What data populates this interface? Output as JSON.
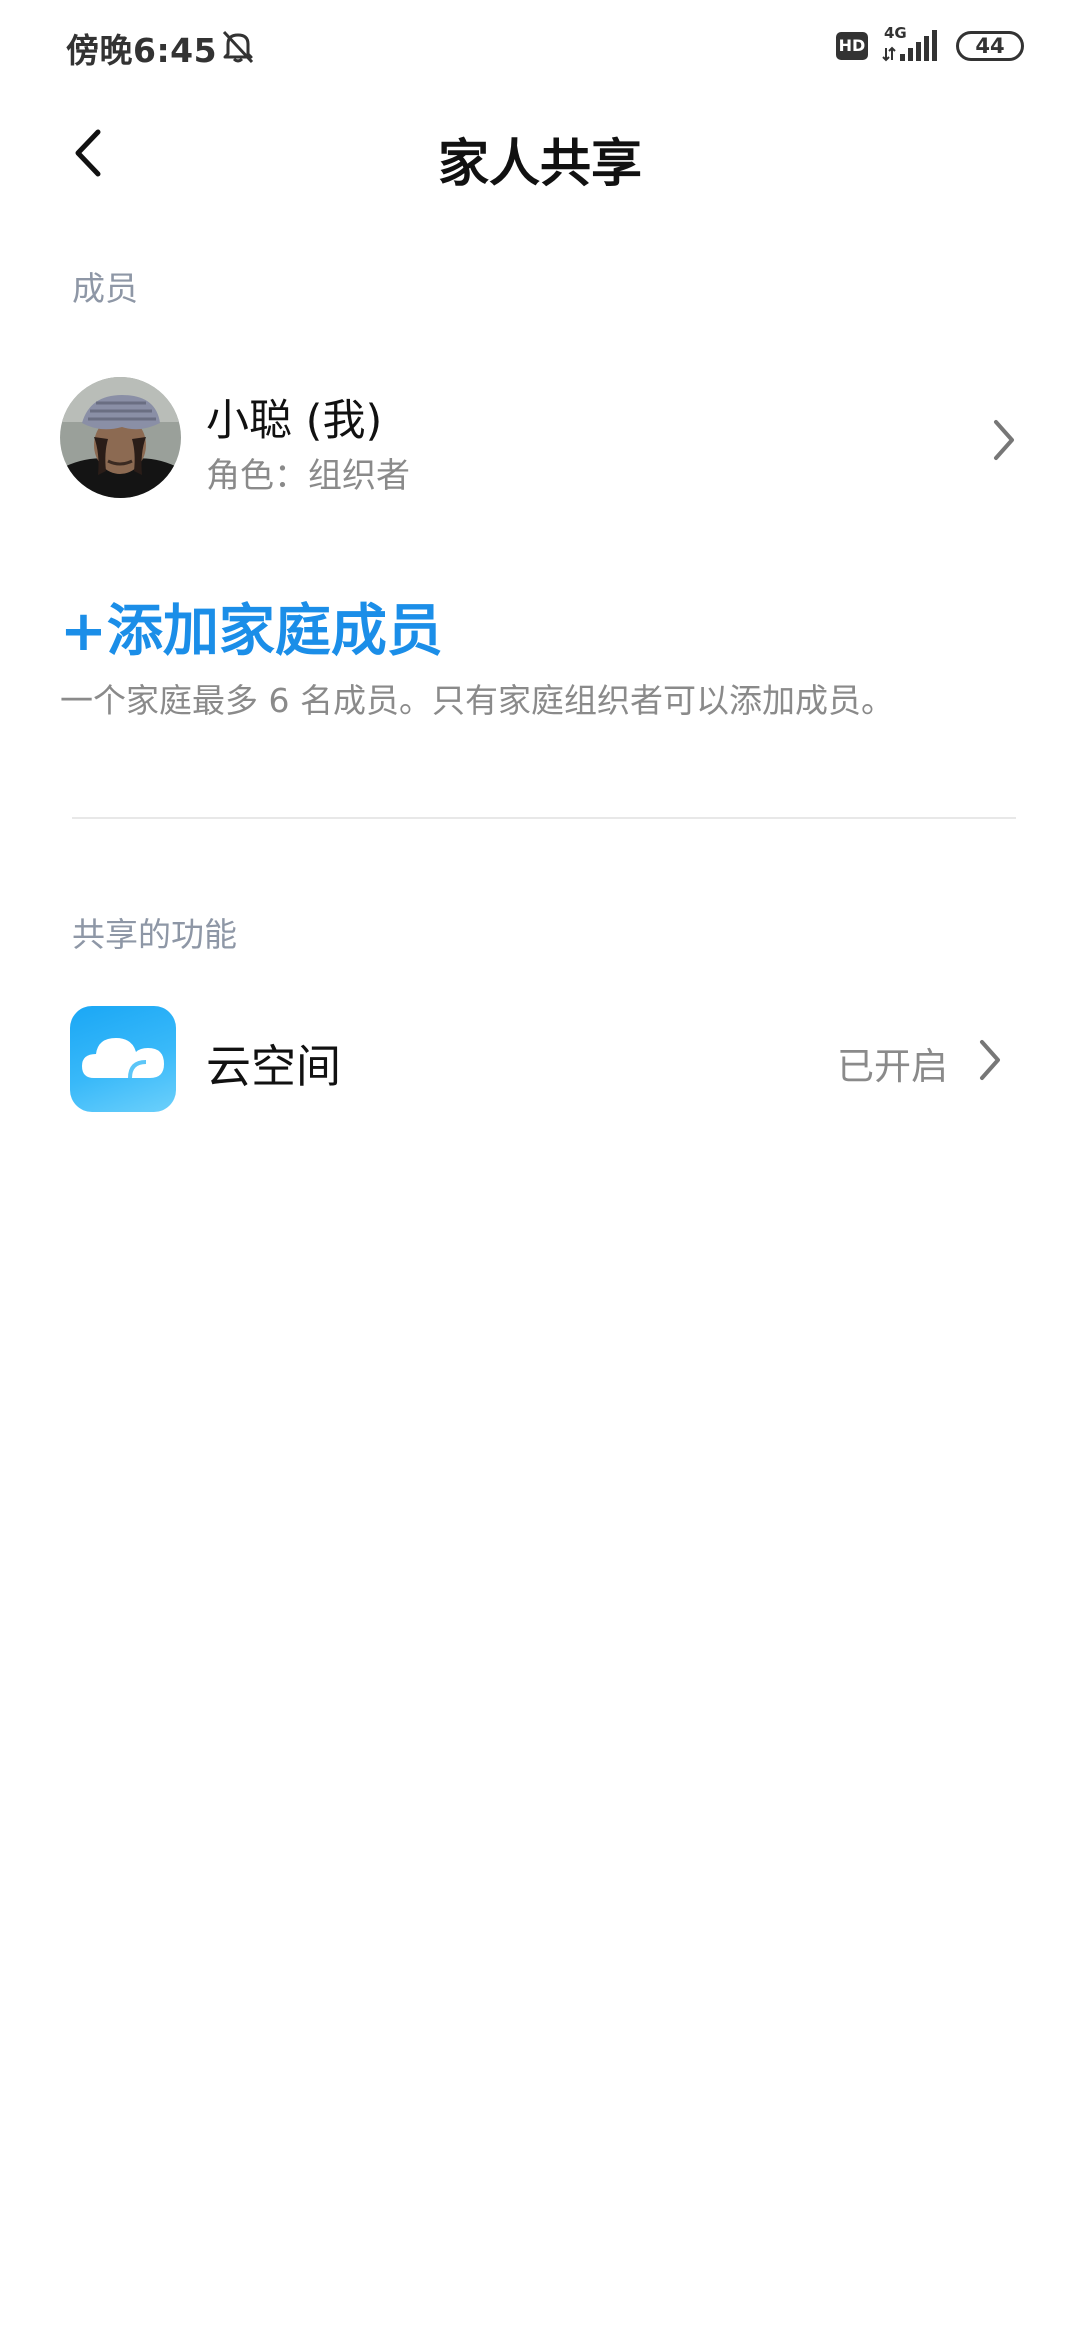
{
  "status_bar": {
    "time": "傍晚6:45",
    "hd": "HD",
    "network": "4G",
    "battery": "44",
    "icons": [
      "bell-off-icon",
      "hd-icon",
      "signal-icon",
      "battery-icon"
    ]
  },
  "header": {
    "title": "家人共享",
    "back_icon": "chevron-left-icon"
  },
  "members_section": {
    "label": "成员",
    "members": [
      {
        "name": "小聪 (我)",
        "role": "角色：组织者",
        "avatar": "user-avatar"
      }
    ],
    "add_label": "+添加家庭成员",
    "add_hint": "一个家庭最多 6 名成员。只有家庭组织者可以添加成员。"
  },
  "features_section": {
    "label": "共享的功能",
    "features": [
      {
        "name": "云空间",
        "status": "已开启",
        "icon": "cloud-icon"
      }
    ]
  },
  "colors": {
    "accent": "#1b8ee8",
    "secondary_text": "#8a8a8a",
    "section_label": "#8e97a6"
  }
}
